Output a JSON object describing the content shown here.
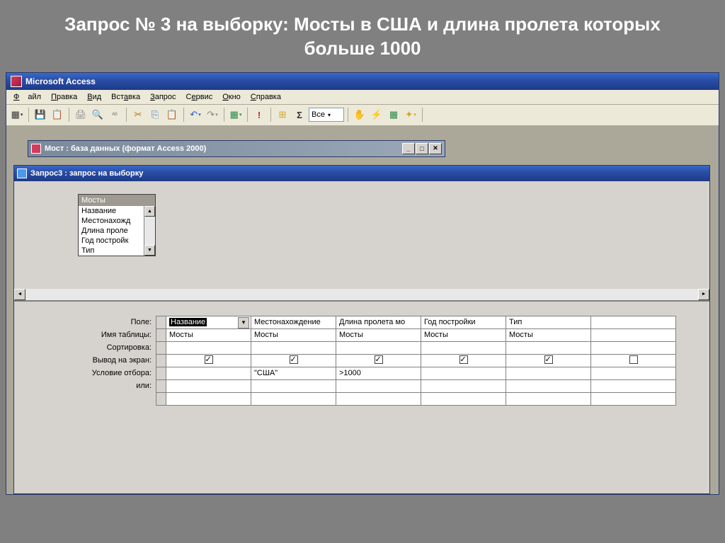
{
  "slide": {
    "title": "Запрос № 3 на выборку: Мосты в США и длина пролета которых больше 1000"
  },
  "app": {
    "title": "Microsoft Access"
  },
  "menu": {
    "file": "Файл",
    "edit": "Правка",
    "view": "Вид",
    "insert": "Вставка",
    "query": "Запрос",
    "tools": "Сервис",
    "window": "Окно",
    "help": "Справка"
  },
  "toolbar": {
    "combo": "Все"
  },
  "db_window": {
    "title": "Мост : база данных (формат Access 2000)"
  },
  "query_window": {
    "title": "Запрос3 : запрос на выборку"
  },
  "table_box": {
    "title": "Мосты",
    "fields": [
      "Название",
      "Местонахожд",
      "Длина проле",
      "Год постройк",
      "Тип"
    ]
  },
  "grid": {
    "labels": {
      "field": "Поле:",
      "table": "Имя таблицы:",
      "sort": "Сортировка:",
      "show": "Вывод на экран:",
      "criteria": "Условие отбора:",
      "or": "или:"
    },
    "columns": [
      {
        "field": "Название",
        "table": "Мосты",
        "show": true,
        "criteria": ""
      },
      {
        "field": "Местонахождение",
        "table": "Мосты",
        "show": true,
        "criteria": "\"США\""
      },
      {
        "field": "Длина пролета мо",
        "table": "Мосты",
        "show": true,
        "criteria": ">1000"
      },
      {
        "field": "Год постройки",
        "table": "Мосты",
        "show": true,
        "criteria": ""
      },
      {
        "field": "Тип",
        "table": "Мосты",
        "show": true,
        "criteria": ""
      }
    ]
  }
}
